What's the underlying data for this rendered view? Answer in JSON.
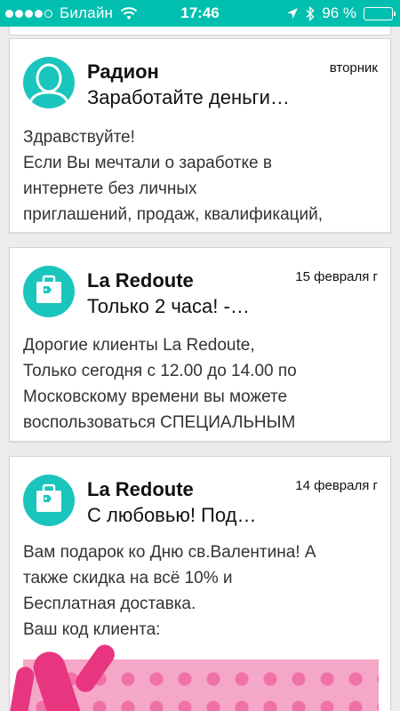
{
  "status_bar": {
    "carrier": "Билайн",
    "time": "17:46",
    "battery_percent": "96 %",
    "battery_level": 0.96,
    "signal_bars": 4,
    "icons": [
      "signal-dots-icon",
      "wifi-icon",
      "location-arrow-icon",
      "bluetooth-icon",
      "battery-icon"
    ]
  },
  "emails": [
    {
      "sender": "Радион",
      "subject": "Заработайте деньги…",
      "date": "вторник",
      "preview_lines": [
        "Здравствуйте!",
        "Если Вы мечтали о заработке в",
        "интернете без личных",
        "приглашений, продаж, квалификаций,"
      ],
      "avatar": "person-avatar-icon"
    },
    {
      "sender": "La Redoute",
      "subject": "Только 2 часа! -…",
      "date": "15 февраля  г",
      "preview_lines": [
        "Дорогие клиенты La Redoute,",
        "Только сегодня с 12.00 до 14.00 по",
        "Московскому времени вы можете",
        "воспользоваться СПЕЦИАЛЬНЫМ"
      ],
      "avatar": "shopping-bag-icon"
    },
    {
      "sender": "La Redoute",
      "subject": "С любовью! Под…",
      "date": "14 февраля  г",
      "preview_lines": [
        "Вам подарок ко Дню св.Валентина! А",
        "также скидка на всё 10% и",
        "Бесплатная доставка.",
        "Ваш код клиента:"
      ],
      "avatar": "shopping-bag-icon"
    }
  ],
  "colors": {
    "accent": "#00bfae",
    "avatar_bg": "#1ac5bd",
    "card_bg": "#ffffff",
    "page_bg": "#ececec"
  }
}
